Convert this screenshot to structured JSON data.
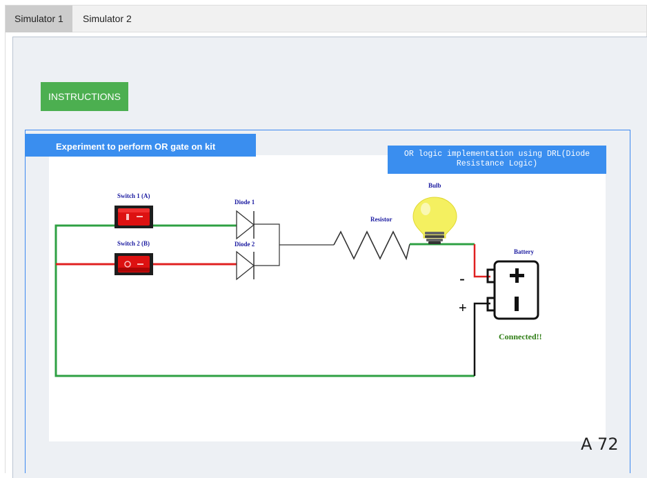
{
  "tabs": [
    {
      "label": "Simulator 1",
      "active": true
    },
    {
      "label": "Simulator 2",
      "active": false
    }
  ],
  "instructions_label": "INSTRUCTIONS",
  "experiment_title": "Experiment to perform OR gate on kit",
  "or_title_line1": "OR logic implementation using DRL(Diode",
  "or_title_line2": "Resistance Logic)",
  "components": {
    "switch1": "Switch 1 (A)",
    "switch2": "Switch 2 (B)",
    "diode1": "Diode 1",
    "diode2": "Diode 2",
    "resistor": "Resistor",
    "bulb": "Bulb",
    "battery": "Battery"
  },
  "battery_minus": "-",
  "battery_plus": "+",
  "status": "Connected!!",
  "page_id": "A 72",
  "colors": {
    "wire_on": "#2ea043",
    "wire_off": "#e02020",
    "accent_blue": "#3a8eef",
    "instructions_green": "#4caf50"
  }
}
